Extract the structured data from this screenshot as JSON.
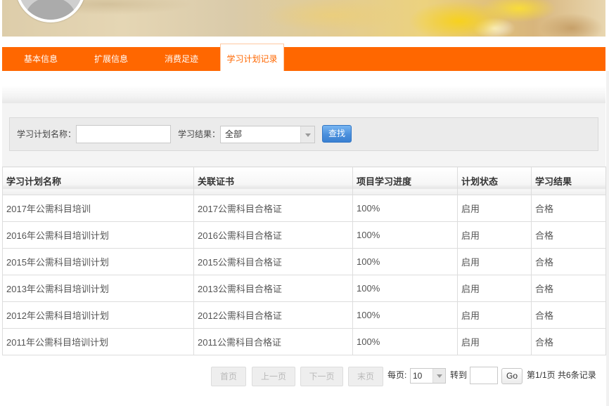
{
  "colors": {
    "accent": "#ff6700",
    "button_primary": "#4a8fdc"
  },
  "profile": {
    "avatar_icon": "user-avatar-icon"
  },
  "tabs": [
    {
      "label": "基本信息",
      "active": false
    },
    {
      "label": "扩展信息",
      "active": false
    },
    {
      "label": "消费足迹",
      "active": false
    },
    {
      "label": "学习计划记录",
      "active": true
    }
  ],
  "search": {
    "name_label": "学习计划名称：",
    "name_value": "",
    "result_label": "学习结果：",
    "result_value": "全部",
    "result_icon": "caret-down-icon",
    "submit_label": "查找"
  },
  "table": {
    "columns": [
      "学习计划名称",
      "关联证书",
      "项目学习进度",
      "计划状态",
      "学习结果"
    ],
    "rows": [
      [
        "2017年公需科目培训",
        "2017公需科目合格证",
        "100%",
        "启用",
        "合格"
      ],
      [
        "2016年公需科目培训计划",
        "2016公需科目合格证",
        "100%",
        "启用",
        "合格"
      ],
      [
        "2015年公需科目培训计划",
        "2015公需科目合格证",
        "100%",
        "启用",
        "合格"
      ],
      [
        "2013年公需科目培训计划",
        "2013公需科目合格证",
        "100%",
        "启用",
        "合格"
      ],
      [
        "2012年公需科目培训计划",
        "2012公需科目合格证",
        "100%",
        "启用",
        "合格"
      ],
      [
        "2011年公需科目培训计划",
        "2011公需科目合格证",
        "100%",
        "启用",
        "合格"
      ]
    ]
  },
  "pagination": {
    "first_label": "首页",
    "prev_label": "上一页",
    "next_label": "下一页",
    "last_label": "末页",
    "per_page_label": "每页:",
    "per_page_value": "10",
    "per_page_icon": "caret-down-icon",
    "goto_label": "转到",
    "goto_value": "",
    "go_label": "Go",
    "summary": "第1/1页 共6条记录"
  }
}
